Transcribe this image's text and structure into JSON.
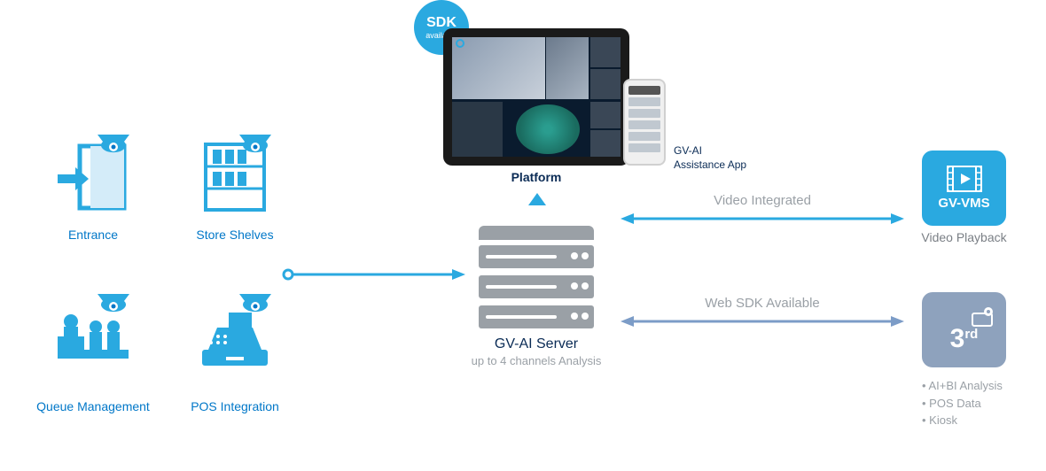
{
  "sdk_badge": {
    "title": "SDK",
    "subtitle": "available"
  },
  "platform": {
    "label": "Platform",
    "app_line1": "GV-AI",
    "app_line2": "Assistance App"
  },
  "server": {
    "title": "GV-AI Server",
    "subtitle": "up to 4 channels Analysis"
  },
  "sources": {
    "entrance": "Entrance",
    "shelves": "Store Shelves",
    "queue": "Queue Management",
    "pos": "POS Integration"
  },
  "links": {
    "video": "Video Integrated",
    "websdk": "Web SDK Available"
  },
  "right": {
    "vms_title": "GV-VMS",
    "vms_sub": "Video Playback",
    "third_title": "3",
    "third_sup": "rd",
    "bullets": [
      "• AI+BI Analysis",
      "• POS Data",
      "• Kiosk"
    ]
  }
}
